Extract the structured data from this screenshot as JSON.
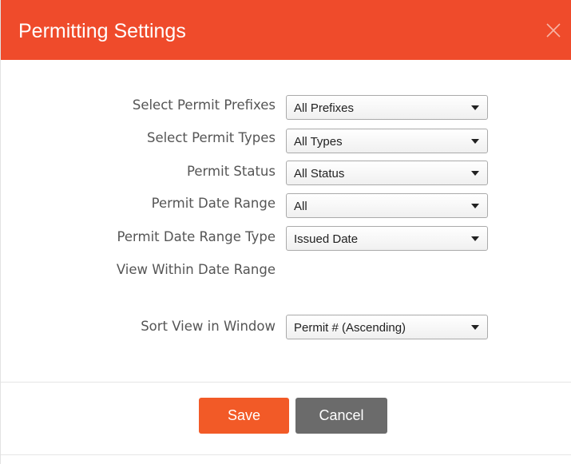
{
  "dialog": {
    "title": "Permitting Settings",
    "close_icon": "close-icon",
    "header_color": "#ef4b2b"
  },
  "form": {
    "prefixes": {
      "label": "Select Permit Prefixes",
      "value": "All Prefixes"
    },
    "types": {
      "label": "Select Permit Types",
      "value": "All Types"
    },
    "status": {
      "label": "Permit Status",
      "value": "All Status"
    },
    "date_range": {
      "label": "Permit Date Range",
      "value": "All"
    },
    "date_range_type": {
      "label": "Permit Date Range Type",
      "value": "Issued Date"
    },
    "view_within": {
      "label": "View Within Date Range"
    },
    "sort": {
      "label": "Sort View in Window",
      "value": "Permit # (Ascending)"
    }
  },
  "footer": {
    "save_label": "Save",
    "cancel_label": "Cancel",
    "save_color": "#f25a27",
    "cancel_color": "#6b6b6b"
  }
}
